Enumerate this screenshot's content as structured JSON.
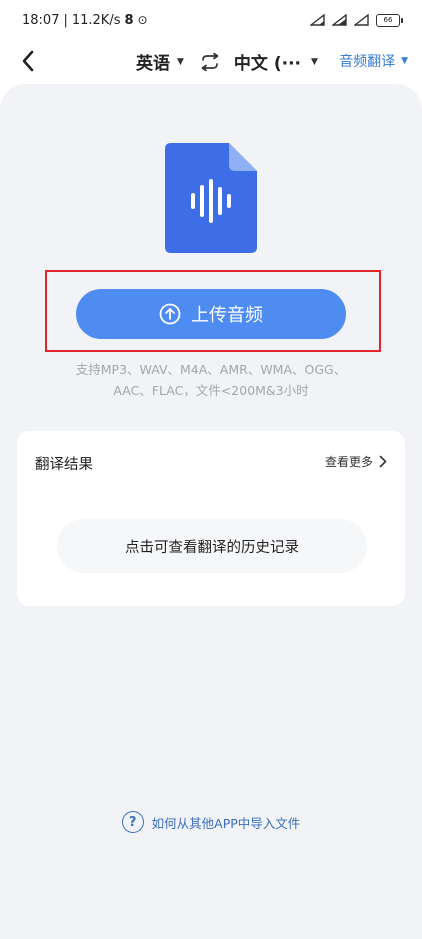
{
  "status_bar": {
    "time": "18:07",
    "speed": "11.2K/s",
    "extra": "8",
    "alarm": "⊙",
    "battery": "66"
  },
  "nav": {
    "source_lang": "英语",
    "target_lang": "中文 (···",
    "mode": "音频翻译"
  },
  "upload": {
    "button_label": "上传音频",
    "formats_line1": "支持MP3、WAV、M4A、AMR、WMA、OGG、",
    "formats_line2": "AAC、FLAC，文件<200M&3小时"
  },
  "result": {
    "title": "翻译结果",
    "more": "查看更多",
    "history": "点击可查看翻译的历史记录"
  },
  "help": {
    "text": "如何从其他APP中导入文件",
    "icon_glyph": "?"
  },
  "colors": {
    "accent": "#4e8cf2",
    "file_icon": "#3d6de7",
    "highlight": "#e0252b",
    "panel_bg": "#f2f3f6"
  }
}
